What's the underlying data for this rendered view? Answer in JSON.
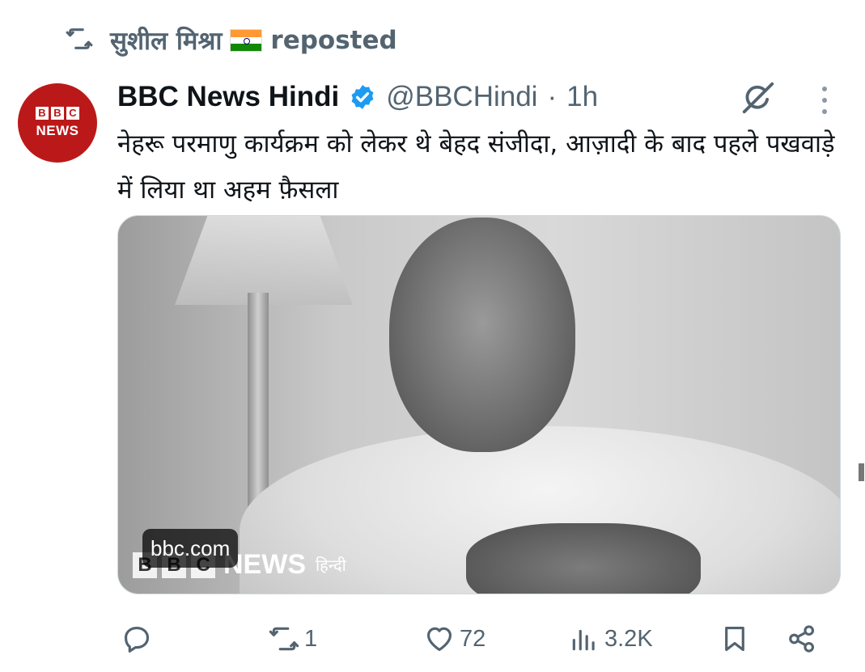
{
  "repost": {
    "user_name": "सुशील मिश्रा",
    "label": "reposted"
  },
  "author": {
    "name": "BBC News Hindi",
    "handle": "@BBCHindi",
    "separator": "·",
    "time": "1h",
    "avatar_text": {
      "blocks": [
        "B",
        "B",
        "C"
      ],
      "news": "NEWS"
    }
  },
  "tweet": {
    "text": "नेहरू परमाणु कार्यक्रम को लेकर थे बेहद संजीदा, आज़ादी के बाद पहले पखवाड़े में लिया था अहम फ़ैसला"
  },
  "media": {
    "domain": "bbc.com",
    "watermark": {
      "blocks": [
        "B",
        "B",
        "C"
      ],
      "news": "NEWS",
      "hindi": "हिन्दी"
    }
  },
  "actions": {
    "replies": "",
    "reposts": "1",
    "likes": "72",
    "views": "3.2K"
  },
  "icons": {
    "repost": "repost-icon",
    "verified": "verified-badge-icon",
    "grok": "grok-icon",
    "more": "more-icon",
    "reply": "reply-icon",
    "like": "heart-icon",
    "views": "views-icon",
    "bookmark": "bookmark-icon",
    "share": "share-icon"
  },
  "colors": {
    "bbc_red": "#bb1919",
    "verified_blue": "#1d9bf0",
    "secondary_text": "#536471"
  }
}
